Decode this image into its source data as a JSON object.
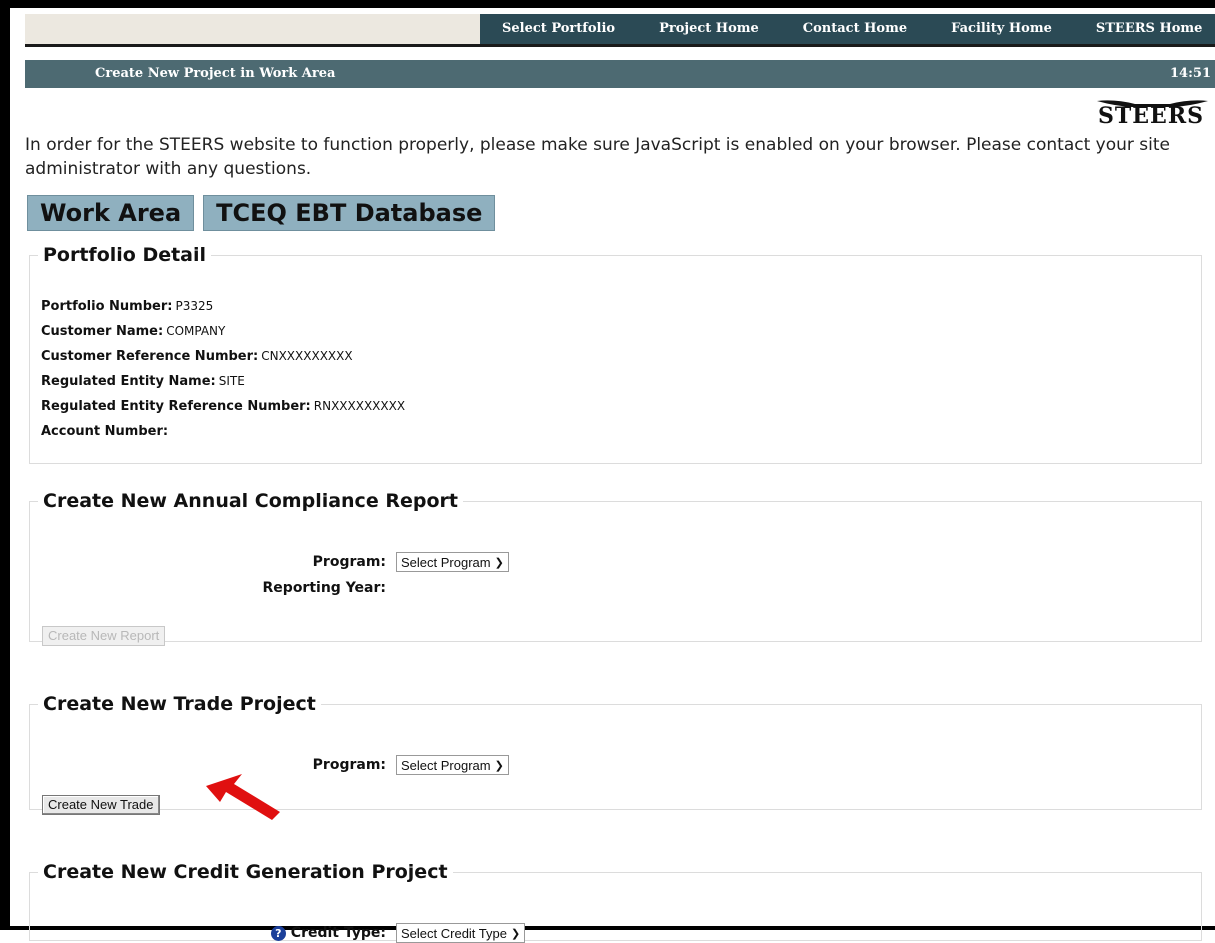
{
  "nav": {
    "items": [
      {
        "label": "Select Portfolio"
      },
      {
        "label": "Project Home"
      },
      {
        "label": "Contact Home"
      },
      {
        "label": "Facility Home"
      },
      {
        "label": "STEERS Home"
      }
    ]
  },
  "titlebar": {
    "title": "Create New Project in Work Area",
    "time": "14:51"
  },
  "logo": {
    "text": "STEERS"
  },
  "notice": "In order for the STEERS website to function properly, please make sure JavaScript is enabled on your browser. Please contact your site administrator with any questions.",
  "tabs": [
    {
      "label": "Work Area"
    },
    {
      "label": "TCEQ EBT Database"
    }
  ],
  "portfolio": {
    "title": "Portfolio Detail",
    "fields": [
      {
        "label": "Portfolio Number:",
        "value": "P3325"
      },
      {
        "label": "Customer Name:",
        "value": "COMPANY"
      },
      {
        "label": "Customer Reference Number:",
        "value": "CNXXXXXXXXX"
      },
      {
        "label": "Regulated Entity Name:",
        "value": "SITE"
      },
      {
        "label": "Regulated Entity Reference Number:",
        "value": "RNXXXXXXXXX"
      },
      {
        "label": "Account Number:",
        "value": ""
      }
    ]
  },
  "annual": {
    "title": "Create New Annual Compliance Report",
    "program_label": "Program:",
    "program_value": "Select Program",
    "year_label": "Reporting Year:",
    "button": "Create New Report"
  },
  "trade": {
    "title": "Create New Trade Project",
    "program_label": "Program:",
    "program_value": "Select Program",
    "button": "Create New Trade"
  },
  "credit": {
    "title": "Create New Credit Generation Project",
    "type_label": "Credit Type:",
    "type_value": "Select Credit Type"
  },
  "colors": {
    "nav_bg": "#2b4a55",
    "title_bg": "#4d6a72",
    "tab_bg": "#8fb0bf",
    "arrow": "#e01010"
  }
}
